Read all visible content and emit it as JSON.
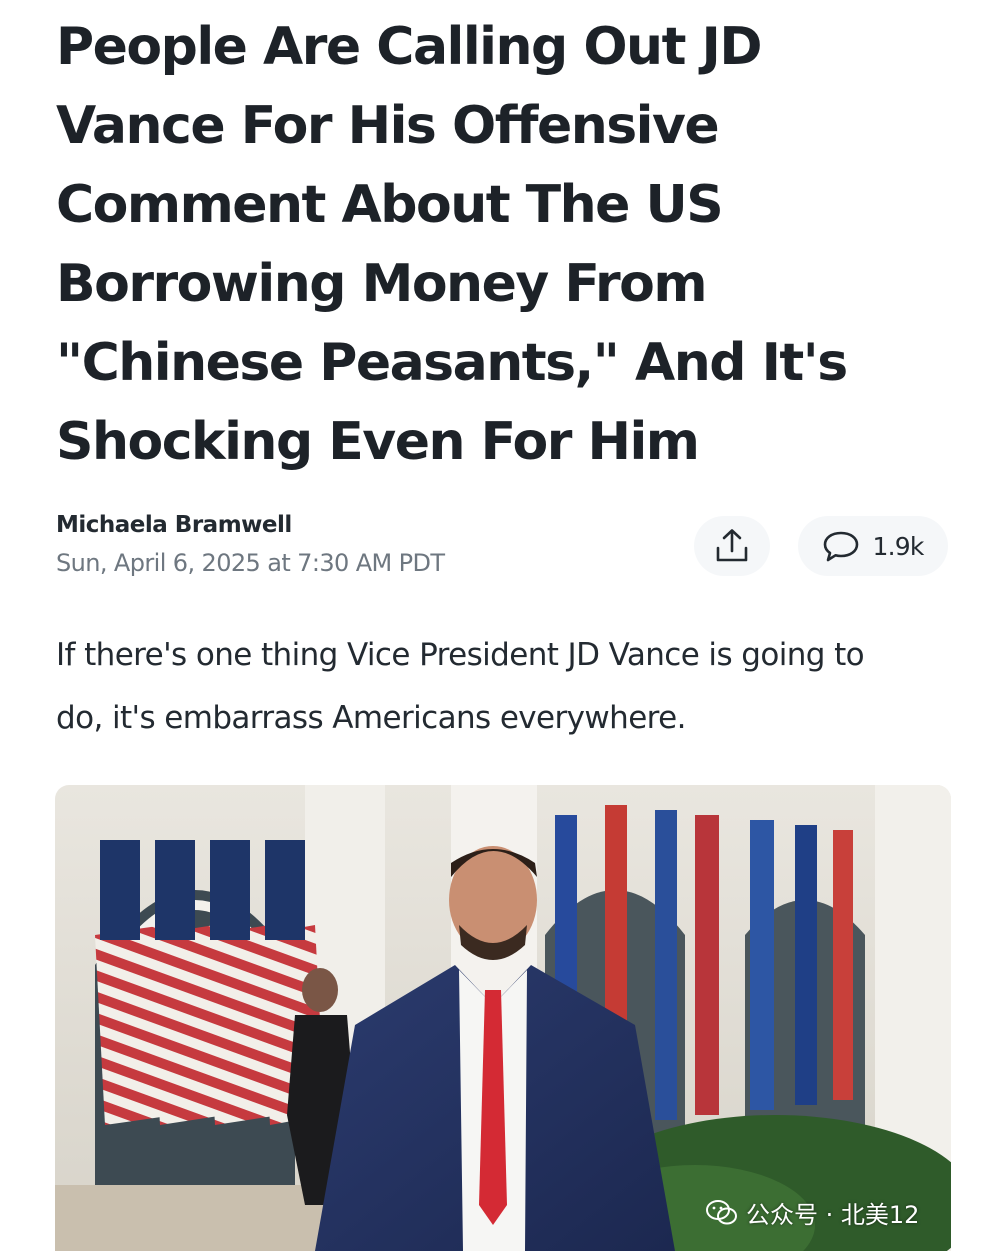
{
  "article": {
    "headline_lines": [
      "People Are Calling Out JD",
      "Vance For His Offensive",
      "Comment About The US",
      "Borrowing Money From",
      "\"Chinese Peasants,\" And It's",
      "Shocking Even For Him"
    ],
    "author": "Michaela Bramwell",
    "date": "Sun, April 6, 2025 at 7:30 AM PDT",
    "body_lines": [
      "If there's one thing Vice President JD Vance is going to",
      "do, it's embarrass Americans everywhere."
    ]
  },
  "actions": {
    "share_icon": "share-upload-icon",
    "comment_icon": "comment-bubble-icon",
    "comment_count": "1.9k"
  },
  "watermark": {
    "text": "公众号 · 北美12"
  },
  "colors": {
    "headline": "#1d2228",
    "meta": "#6e7780",
    "button_bg": "#f5f7f9"
  }
}
